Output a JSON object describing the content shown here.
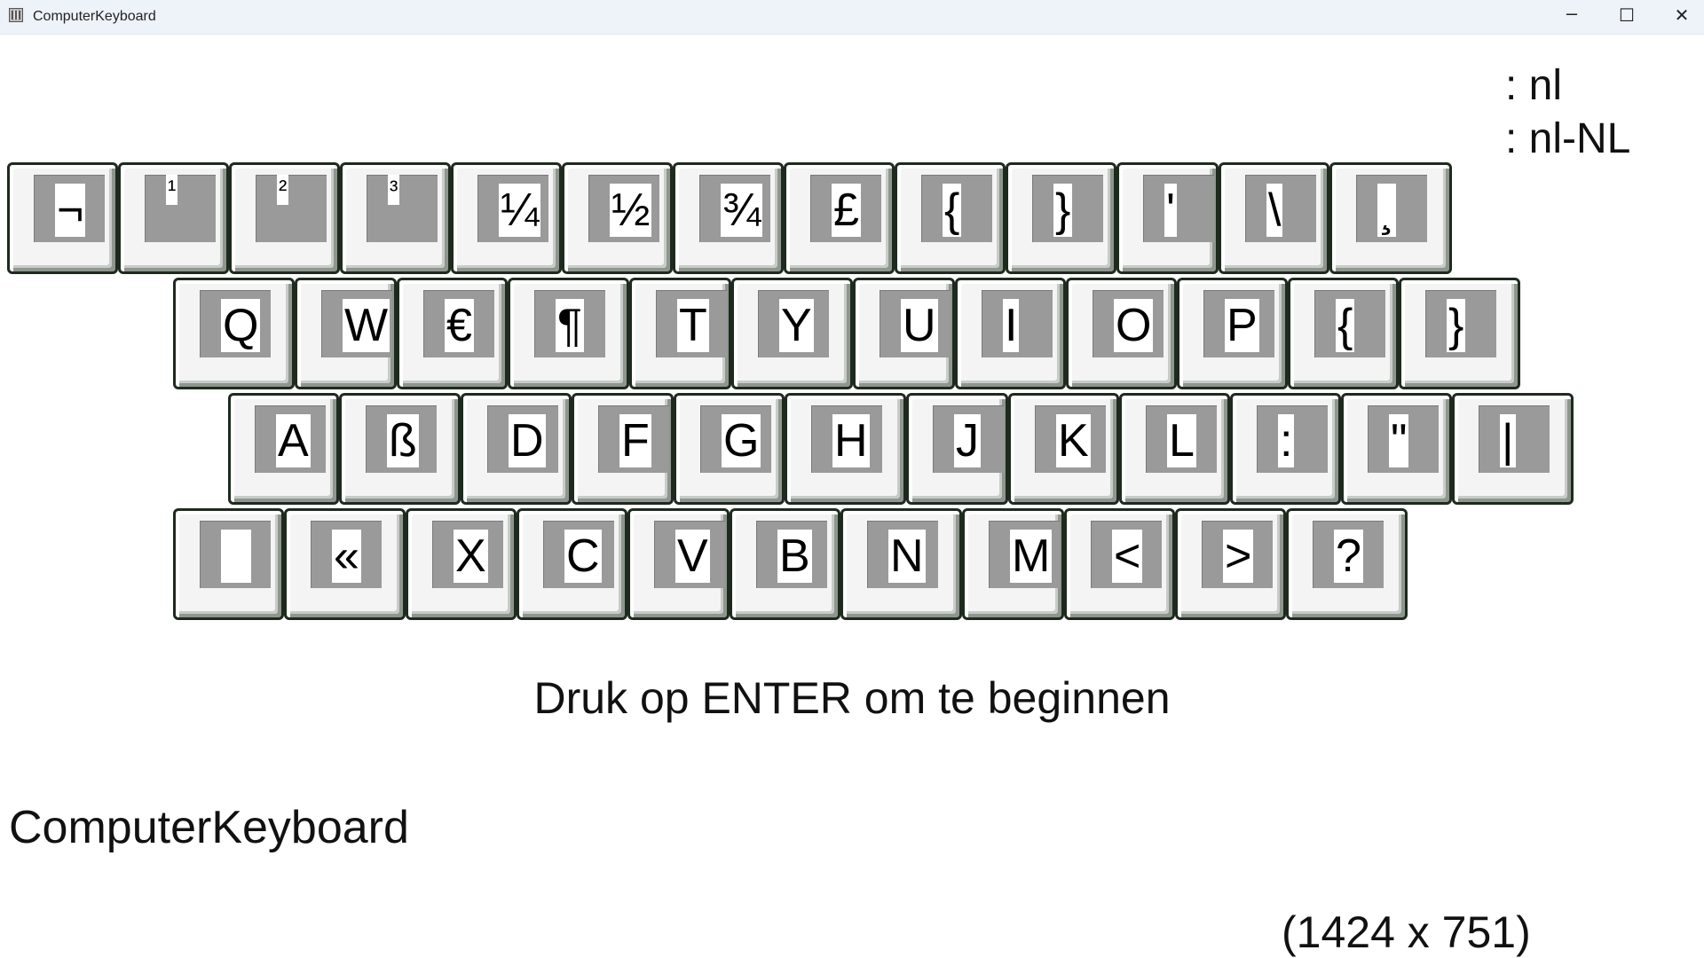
{
  "window": {
    "title": "ComputerKeyboard",
    "controls": {
      "minimize": "–",
      "maximize": "☐",
      "close": "✕"
    }
  },
  "locale": {
    "language": ": nl",
    "culture": ": nl-NL"
  },
  "keyboard": {
    "rows": [
      [
        "¬",
        "¹",
        "²",
        "³",
        "¼",
        "½",
        "¾",
        "£",
        "{",
        "}",
        "'",
        "\\",
        "¸"
      ],
      [
        "Q",
        "W",
        "€",
        "¶",
        "T",
        "Y",
        "U",
        "I",
        "O",
        "P",
        "{",
        "}"
      ],
      [
        "A",
        "ß",
        "D",
        "F",
        "G",
        "H",
        "J",
        "K",
        "L",
        ":",
        "\"",
        "|"
      ],
      [
        " ",
        "«",
        "X",
        "C",
        "V",
        "B",
        "N",
        "M",
        "<",
        ">",
        "?"
      ]
    ]
  },
  "prompt": "Druk op ENTER om te beginnen",
  "app_name": "ComputerKeyboard",
  "dimensions": "(1424 x 751)",
  "colors": {
    "background": "#ffffff",
    "titlebar": "#eef2f9",
    "key_face": "#f4f4f4",
    "key_cap": "#9a9a9a",
    "key_border": "#1f2a1f"
  }
}
